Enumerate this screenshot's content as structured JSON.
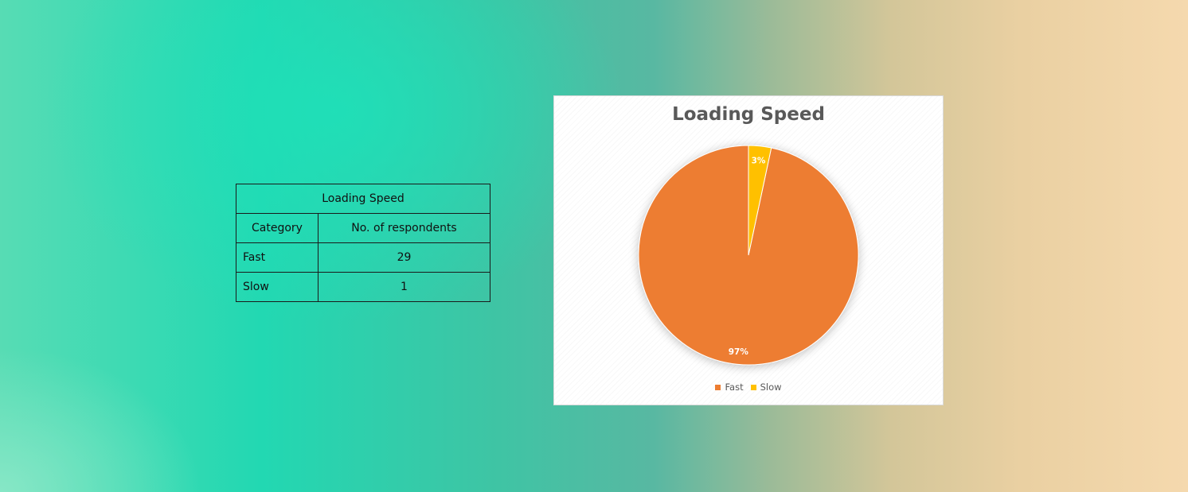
{
  "table": {
    "title": "Loading Speed",
    "headers": [
      "Category",
      "No. of respondents"
    ],
    "rows": [
      {
        "category": "Fast",
        "value": "29"
      },
      {
        "category": "Slow",
        "value": "1"
      }
    ]
  },
  "chart_data": {
    "type": "pie",
    "title": "Loading Speed",
    "categories": [
      "Fast",
      "Slow"
    ],
    "values": [
      29,
      1
    ],
    "data_labels": [
      "97%",
      "3%"
    ],
    "colors": [
      "#ED7D31",
      "#FFC000"
    ],
    "legend_position": "bottom"
  }
}
